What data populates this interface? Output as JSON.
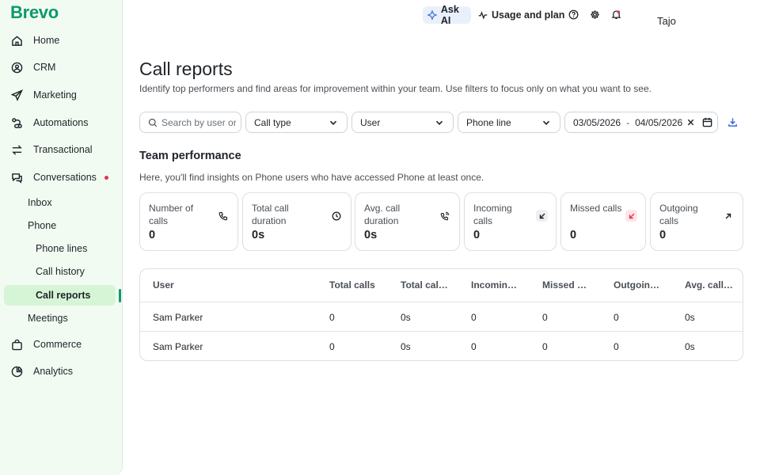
{
  "brand": {
    "logo_text": "Brevo",
    "accent": "#0b996e"
  },
  "sidebar": {
    "items": [
      {
        "label": "Home",
        "icon": "home-icon"
      },
      {
        "label": "CRM",
        "icon": "contacts-icon"
      },
      {
        "label": "Marketing",
        "icon": "send-icon"
      },
      {
        "label": "Automations",
        "icon": "automation-icon"
      },
      {
        "label": "Transactional",
        "icon": "transfer-icon"
      },
      {
        "label": "Conversations",
        "icon": "chat-icon"
      },
      {
        "label": "Commerce",
        "icon": "bag-icon"
      },
      {
        "label": "Analytics",
        "icon": "pie-chart-icon"
      }
    ],
    "conversations_sub": [
      "Inbox",
      "Phone",
      "Meetings"
    ],
    "phone_sub": [
      "Phone lines",
      "Call history",
      "Call reports"
    ],
    "active": "Call reports"
  },
  "topbar": {
    "ask_ai": "Ask AI",
    "usage": "Usage and plan",
    "user_name": "Tajo"
  },
  "page": {
    "title": "Call reports",
    "subtitle": "Identify top performers and find areas for improvement within your team. Use filters to focus only on what you want to see."
  },
  "filters": {
    "search_placeholder": "Search by user or email",
    "call_type": "Call type",
    "user": "User",
    "phone_line": "Phone line",
    "date_from": "03/05/2026",
    "date_sep": "-",
    "date_to": "04/05/2026"
  },
  "team": {
    "title": "Team performance",
    "subtitle": "Here, you'll find insights on Phone users who have accessed Phone at least once."
  },
  "cards": [
    {
      "label": "Number of calls",
      "value": "0",
      "icon": "phone-icon"
    },
    {
      "label": "Total call duration",
      "value": "0s",
      "icon": "clock-icon"
    },
    {
      "label": "Avg. call duration",
      "value": "0s",
      "icon": "phone-waves-icon"
    },
    {
      "label": "Incoming calls",
      "value": "0",
      "icon": "arrow-down-left-icon"
    },
    {
      "label": "Missed calls",
      "value": "0",
      "icon": "missed-arrow-icon"
    },
    {
      "label": "Outgoing calls",
      "value": "0",
      "icon": "arrow-up-right-icon"
    }
  ],
  "table": {
    "columns": [
      "User",
      "Total calls",
      "Total call…",
      "Incoming…",
      "Missed c…",
      "Outgoing…",
      "Avg. call …"
    ],
    "rows": [
      [
        "Sam Parker",
        "0",
        "0s",
        "0",
        "0",
        "0",
        "0s"
      ],
      [
        "Sam Parker",
        "0",
        "0s",
        "0",
        "0",
        "0",
        "0s"
      ]
    ]
  }
}
